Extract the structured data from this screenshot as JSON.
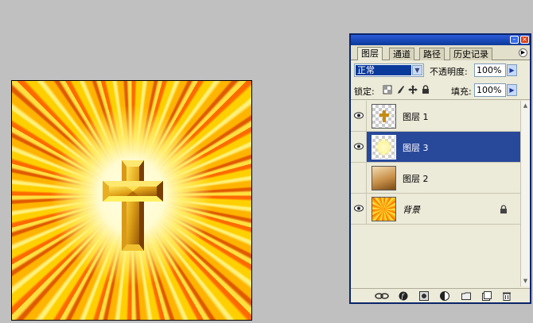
{
  "palette": {
    "tabs": [
      {
        "label": "图层",
        "active": true
      },
      {
        "label": "通道",
        "active": false
      },
      {
        "label": "路径",
        "active": false
      },
      {
        "label": "历史记录",
        "active": false
      }
    ],
    "blend_mode": "正常",
    "opacity_label": "不透明度:",
    "opacity_value": "100%",
    "lock_label": "锁定:",
    "fill_label": "填充:",
    "fill_value": "100%",
    "layers": [
      {
        "name": "图层 1",
        "selected": false,
        "visible": true,
        "thumb": "cross-on-transparent"
      },
      {
        "name": "图层 3",
        "selected": true,
        "visible": true,
        "thumb": "glow-on-transparent"
      },
      {
        "name": "图层 2",
        "selected": false,
        "visible": false,
        "thumb": "brown-gradient"
      },
      {
        "name": "背景",
        "selected": false,
        "visible": true,
        "locked": true,
        "thumb": "yellow-burst"
      }
    ],
    "bottom_icons": [
      "link-icon",
      "layer-style-icon",
      "mask-icon",
      "adjustment-icon",
      "folder-icon",
      "new-layer-icon",
      "trash-icon"
    ]
  },
  "colors": {
    "selection": "#28489a",
    "panel_bg": "#ecead8",
    "burst_orange": "#ff6a00",
    "burst_yellow": "#ffd000",
    "cross_gold": "#c88a10"
  }
}
